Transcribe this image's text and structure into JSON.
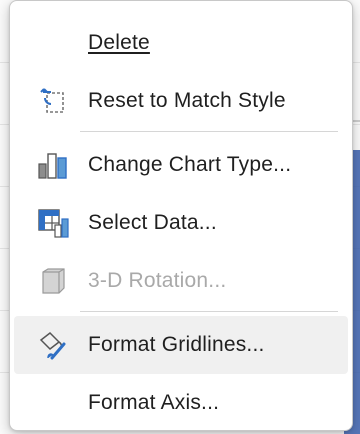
{
  "menu": {
    "items": [
      {
        "label": "Delete",
        "icon": "none"
      },
      {
        "label": "Reset to Match Style",
        "icon": "reset-style-icon"
      },
      {
        "label": "Change Chart Type...",
        "icon": "chart-type-icon"
      },
      {
        "label": "Select Data...",
        "icon": "select-data-icon"
      },
      {
        "label": "3-D Rotation...",
        "icon": "3d-rotation-icon",
        "disabled": true
      },
      {
        "label": "Format Gridlines...",
        "icon": "format-brush-icon",
        "highlighted": true
      },
      {
        "label": "Format Axis...",
        "icon": "none"
      }
    ]
  },
  "colors": {
    "accent": "#2f6fc4",
    "text": "#1f1f1f",
    "disabled_text": "#a9a9a9",
    "hover": "#f0f0f0"
  }
}
